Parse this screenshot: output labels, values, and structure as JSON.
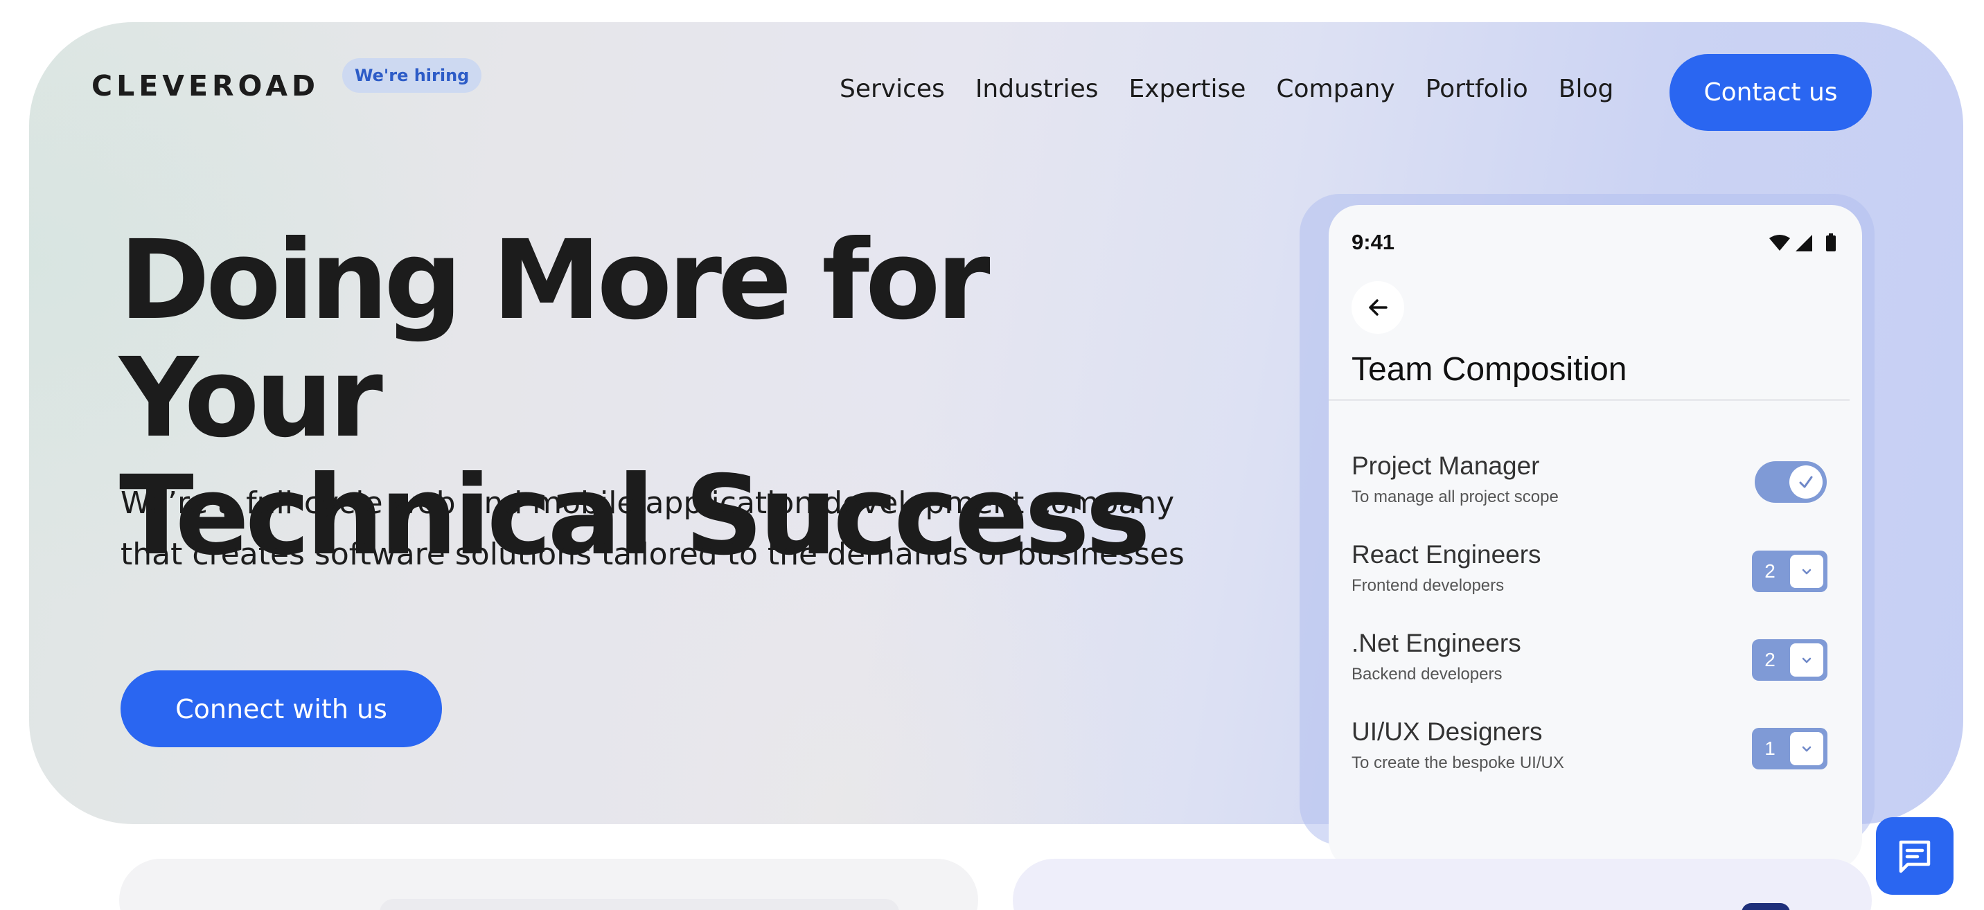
{
  "brand": {
    "logo": "CLEVEROAD",
    "hiring_badge": "We're hiring"
  },
  "nav": {
    "items": [
      "Services",
      "Industries",
      "Expertise",
      "Company",
      "Portfolio",
      "Blog"
    ],
    "cta": "Contact us"
  },
  "hero": {
    "headline_line1": "Doing More for Your",
    "headline_line2": "Technical Success",
    "subhead_line1": "We’re a full-cycle web and mobile application development company",
    "subhead_line2": "that creates software solutions tailored to the demands of businesses",
    "cta": "Connect with us"
  },
  "phone": {
    "status_time": "9:41",
    "title": "Team Composition",
    "rows": [
      {
        "title": "Project Manager",
        "subtitle": "To manage all project scope",
        "control": "toggle",
        "checked": true
      },
      {
        "title": "React Engineers",
        "subtitle": "Frontend developers",
        "control": "stepper",
        "value": "2"
      },
      {
        "title": ".Net Engineers",
        "subtitle": "Backend developers",
        "control": "stepper",
        "value": "2"
      },
      {
        "title": "UI/UX Designers",
        "subtitle": "To create the bespoke UI/UX",
        "control": "stepper",
        "value": "1"
      }
    ]
  },
  "colors": {
    "accent": "#2a66f1",
    "control": "#7f9ad6",
    "badge_bg": "#cdd9f1",
    "badge_text": "#2d5cc7"
  },
  "icons": {
    "back": "arrow-left-icon",
    "wifi": "wifi-icon",
    "signal": "signal-icon",
    "battery": "battery-icon",
    "chevron": "chevron-down-icon",
    "check": "check-icon",
    "chat": "chat-icon"
  }
}
